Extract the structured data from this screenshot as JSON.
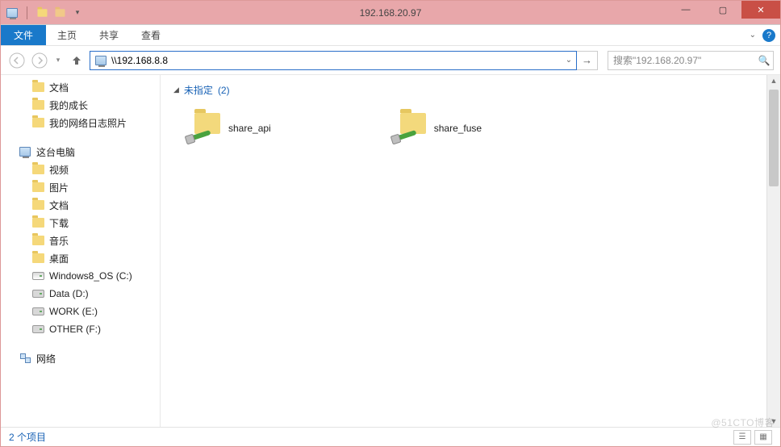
{
  "titlebar": {
    "title": "192.168.20.97"
  },
  "ribbon": {
    "file": "文件",
    "tabs": [
      "主页",
      "共享",
      "查看"
    ]
  },
  "nav": {
    "address": "\\\\192.168.8.8",
    "search_placeholder": "搜索\"192.168.20.97\""
  },
  "sidebar": {
    "quick": [
      {
        "label": "文档",
        "icon": "folder"
      },
      {
        "label": "我的成长",
        "icon": "folder"
      },
      {
        "label": "我的网络日志照片",
        "icon": "folder"
      }
    ],
    "thispc_label": "这台电脑",
    "thispc": [
      {
        "label": "视频",
        "icon": "folder"
      },
      {
        "label": "图片",
        "icon": "folder"
      },
      {
        "label": "文档",
        "icon": "folder"
      },
      {
        "label": "下载",
        "icon": "folder"
      },
      {
        "label": "音乐",
        "icon": "folder"
      },
      {
        "label": "桌面",
        "icon": "folder"
      },
      {
        "label": "Windows8_OS (C:)",
        "icon": "drive"
      },
      {
        "label": "Data (D:)",
        "icon": "drive"
      },
      {
        "label": "WORK (E:)",
        "icon": "drive"
      },
      {
        "label": "OTHER (F:)",
        "icon": "drive"
      }
    ],
    "network_label": "网络"
  },
  "content": {
    "group_label": "未指定",
    "group_count": "(2)",
    "items": [
      {
        "name": "share_api"
      },
      {
        "name": "share_fuse"
      }
    ]
  },
  "statusbar": {
    "text": "2 个项目"
  },
  "watermark": "@51CTO博客"
}
